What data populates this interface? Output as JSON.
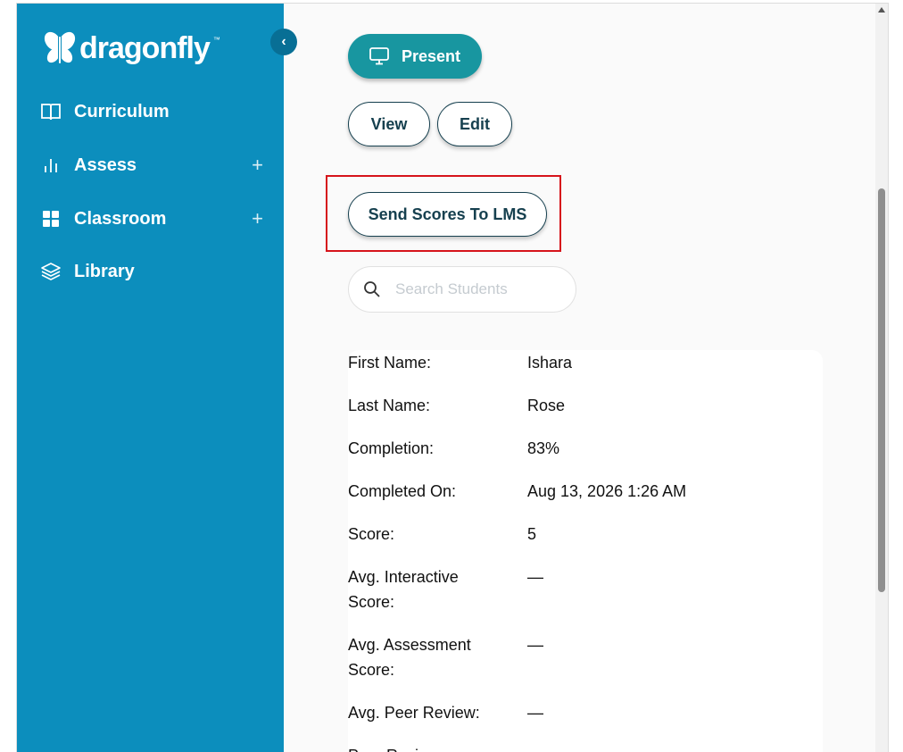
{
  "brand": {
    "name": "dragonfly",
    "tm": "™"
  },
  "sidebar": {
    "items": [
      {
        "label": "Curriculum",
        "icon": "book-icon",
        "expandable": false
      },
      {
        "label": "Assess",
        "icon": "bar-chart-icon",
        "expandable": true
      },
      {
        "label": "Classroom",
        "icon": "grid-icon",
        "expandable": true
      },
      {
        "label": "Library",
        "icon": "layers-icon",
        "expandable": false
      }
    ]
  },
  "toolbar": {
    "present_label": "Present",
    "view_label": "View",
    "edit_label": "Edit",
    "send_scores_label": "Send Scores To LMS"
  },
  "search": {
    "placeholder": "Search Students"
  },
  "student": {
    "fields": [
      {
        "label": "First Name:",
        "value": "Ishara"
      },
      {
        "label": "Last Name:",
        "value": "Rose"
      },
      {
        "label": "Completion:",
        "value": "83%"
      },
      {
        "label": "Completed On:",
        "value": "Aug 13, 2026 1:26 AM"
      },
      {
        "label": "Score:",
        "value": "5"
      },
      {
        "label": "Avg. Interactive Score:",
        "value": "—"
      },
      {
        "label": "Avg. Assessment Score:",
        "value": "—"
      },
      {
        "label": "Avg. Peer Review:",
        "value": "—"
      },
      {
        "label": "Peer Review",
        "value": "—"
      }
    ]
  },
  "colors": {
    "sidebar": "#0c8ebd",
    "present_button": "#1896a0",
    "outline": "#16404f",
    "highlight": "#d6141b"
  }
}
